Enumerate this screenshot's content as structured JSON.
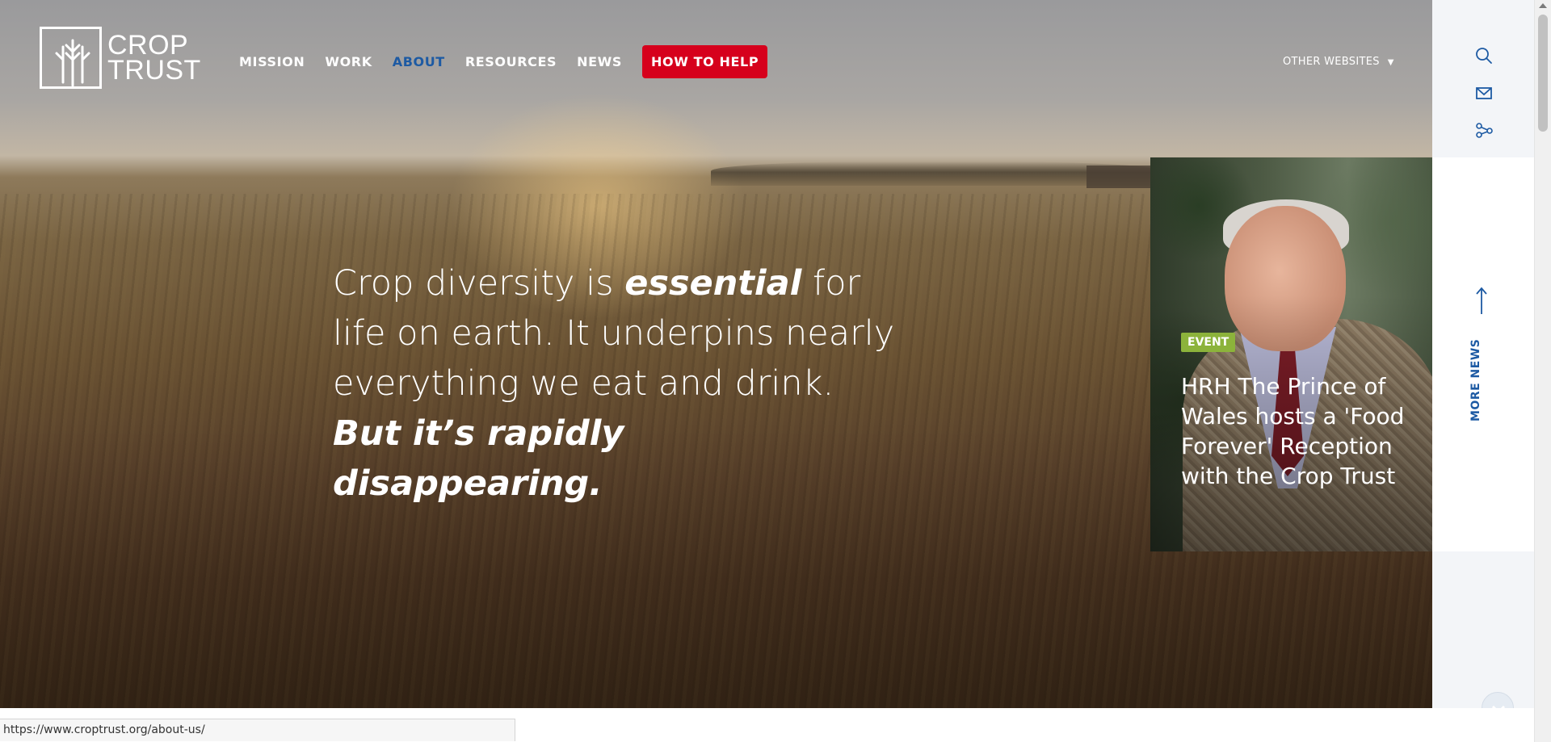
{
  "brand": {
    "line1": "CROP",
    "line2": "TRUST",
    "logo_icon": "wheat-icon"
  },
  "nav": {
    "items": [
      {
        "label": "MISSION",
        "active": false
      },
      {
        "label": "WORK",
        "active": false
      },
      {
        "label": "ABOUT",
        "active": true
      },
      {
        "label": "RESOURCES",
        "active": false
      },
      {
        "label": "NEWS",
        "active": false
      }
    ],
    "cta": "HOW TO HELP"
  },
  "other_websites": "OTHER WEBSITES",
  "hero": {
    "part1": "Crop diversity is ",
    "emphasis": "essential",
    "part2": " for life on earth. It underpins nearly everything we eat and drink.",
    "line2": "But it’s rapidly disappearing."
  },
  "news_card": {
    "badge": "EVENT",
    "headline": "HRH The Prince of Wales hosts a 'Food Forever' Reception with the Crop Trust"
  },
  "rail": {
    "icons": [
      "search-icon",
      "mail-icon",
      "share-icon"
    ],
    "more_news": "MORE NEWS"
  },
  "status_bar": {
    "url": "https://www.croptrust.org/about-us/"
  },
  "colors": {
    "accent_blue": "#1d5aa3",
    "cta_red": "#d6001c",
    "badge_green": "#8cb33b"
  }
}
